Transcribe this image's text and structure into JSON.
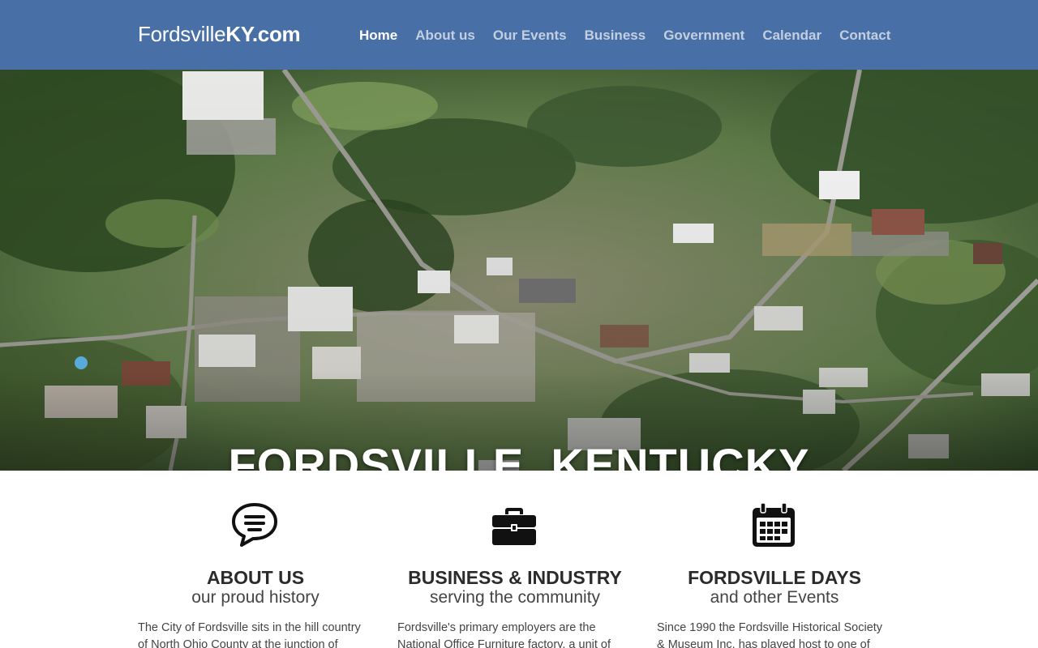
{
  "header": {
    "logo_light": "Fordsville",
    "logo_bold": "KY.com",
    "nav": [
      {
        "label": "Home",
        "active": true
      },
      {
        "label": "About us",
        "active": false
      },
      {
        "label": "Our Events",
        "active": false
      },
      {
        "label": "Business",
        "active": false
      },
      {
        "label": "Government",
        "active": false
      },
      {
        "label": "Calendar",
        "active": false
      },
      {
        "label": "Contact",
        "active": false
      }
    ]
  },
  "hero": {
    "title": "FORDSVILLE, KENTUCKY"
  },
  "features": [
    {
      "icon": "speech-bubble-icon",
      "heading": "ABOUT US",
      "sub": "our proud history",
      "body": "The City of Fordsville sits in the hill country of North Ohio County at the junction of"
    },
    {
      "icon": "briefcase-icon",
      "heading": "BUSINESS & INDUSTRY",
      "sub": "serving the community",
      "body": "Fordsville's primary employers are the National Office Furniture factory, a unit of"
    },
    {
      "icon": "calendar-icon",
      "heading": "FORDSVILLE DAYS",
      "sub": "and other Events",
      "body": "Since 1990 the Fordsville Historical Society & Museum Inc. has played host to one of"
    }
  ],
  "colors": {
    "header_bg": "#4870a6",
    "nav_active": "#ffffff",
    "nav_inactive": "#c3cfe0",
    "heading": "#2b2b2b"
  }
}
